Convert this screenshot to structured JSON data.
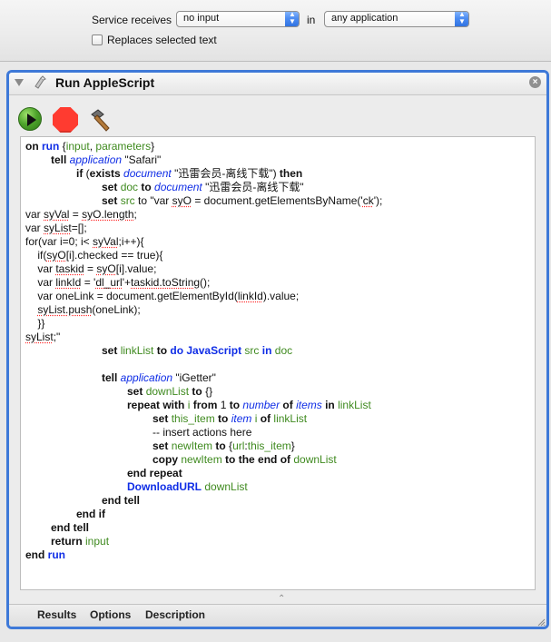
{
  "top": {
    "service_receives_label": "Service receives",
    "input_type_value": "no input",
    "in_label": "in",
    "application_value": "any application",
    "replaces_selected_text_label": "Replaces selected text",
    "replaces_selected_text_checked": false
  },
  "action": {
    "title": "Run AppleScript"
  },
  "code_lines": [
    {
      "indent": 0,
      "segments": [
        {
          "t": "on ",
          "c": "kw"
        },
        {
          "t": "run",
          "c": "kwb"
        },
        {
          "t": " {",
          "c": "str"
        },
        {
          "t": "input",
          "c": "var"
        },
        {
          "t": ", ",
          "c": "str"
        },
        {
          "t": "parameters",
          "c": "var"
        },
        {
          "t": "}",
          "c": "str"
        }
      ]
    },
    {
      "indent": 1,
      "segments": [
        {
          "t": "tell ",
          "c": "kw"
        },
        {
          "t": "application",
          "c": "app"
        },
        {
          "t": " \"Safari\"",
          "c": "str"
        }
      ]
    },
    {
      "indent": 2,
      "segments": [
        {
          "t": "if ",
          "c": "kw"
        },
        {
          "t": "(",
          "c": "str"
        },
        {
          "t": "exists ",
          "c": "kw"
        },
        {
          "t": "document",
          "c": "app"
        },
        {
          "t": " \"迅雷会员-离线下载\") ",
          "c": "str"
        },
        {
          "t": "then",
          "c": "kw"
        }
      ]
    },
    {
      "indent": 3,
      "segments": [
        {
          "t": "set ",
          "c": "kw"
        },
        {
          "t": "doc",
          "c": "var"
        },
        {
          "t": " to ",
          "c": "kw"
        },
        {
          "t": "document",
          "c": "app"
        },
        {
          "t": " \"迅雷会员-离线下载\"",
          "c": "str"
        }
      ]
    },
    {
      "indent": 3,
      "segments": [
        {
          "t": "set ",
          "c": "kw"
        },
        {
          "t": "src",
          "c": "var"
        },
        {
          "t": " to \"var ",
          "c": "str"
        },
        {
          "t": "syO",
          "c": "str",
          "u": true
        },
        {
          "t": " = document.getElementsByName('",
          "c": "str"
        },
        {
          "t": "ck",
          "c": "str",
          "u": true
        },
        {
          "t": "');",
          "c": "str"
        }
      ]
    },
    {
      "indent": 0,
      "segments": [
        {
          "t": "var ",
          "c": "str"
        },
        {
          "t": "syVal",
          "c": "str",
          "u": true
        },
        {
          "t": " = ",
          "c": "str"
        },
        {
          "t": "syO.length",
          "c": "str",
          "u": true
        },
        {
          "t": ";",
          "c": "str"
        }
      ]
    },
    {
      "indent": 0,
      "segments": [
        {
          "t": "var ",
          "c": "str"
        },
        {
          "t": "syList",
          "c": "str",
          "u": true
        },
        {
          "t": "=[];",
          "c": "str"
        }
      ]
    },
    {
      "indent": 0,
      "segments": [
        {
          "t": "for(var i=0; i< ",
          "c": "str"
        },
        {
          "t": "syVal",
          "c": "str",
          "u": true
        },
        {
          "t": ";i++){",
          "c": "str"
        }
      ]
    },
    {
      "indent": 0,
      "segments": [
        {
          "t": "    if(",
          "c": "str"
        },
        {
          "t": "syO",
          "c": "str",
          "u": true
        },
        {
          "t": "[i].checked == true){",
          "c": "str"
        }
      ]
    },
    {
      "indent": 0,
      "segments": [
        {
          "t": "    var ",
          "c": "str"
        },
        {
          "t": "taskid",
          "c": "str",
          "u": true
        },
        {
          "t": " = ",
          "c": "str"
        },
        {
          "t": "syO",
          "c": "str",
          "u": true
        },
        {
          "t": "[i].value;",
          "c": "str"
        }
      ]
    },
    {
      "indent": 0,
      "segments": [
        {
          "t": "    var ",
          "c": "str"
        },
        {
          "t": "linkId",
          "c": "str",
          "u": true
        },
        {
          "t": " = '",
          "c": "str"
        },
        {
          "t": "dl_url",
          "c": "str",
          "u": true
        },
        {
          "t": "'+",
          "c": "str"
        },
        {
          "t": "taskid.toString",
          "c": "str",
          "u": true
        },
        {
          "t": "();",
          "c": "str"
        }
      ]
    },
    {
      "indent": 0,
      "segments": [
        {
          "t": "    var ",
          "c": "str"
        },
        {
          "t": "oneLink",
          "c": "str"
        },
        {
          "t": " = document.getElementById(",
          "c": "str"
        },
        {
          "t": "linkId",
          "c": "str",
          "u": true
        },
        {
          "t": ").value;",
          "c": "str"
        }
      ]
    },
    {
      "indent": 0,
      "segments": [
        {
          "t": "    ",
          "c": "str"
        },
        {
          "t": "syList.push",
          "c": "str",
          "u": true
        },
        {
          "t": "(oneLink);",
          "c": "str"
        }
      ]
    },
    {
      "indent": 0,
      "segments": [
        {
          "t": "    }}",
          "c": "str"
        }
      ]
    },
    {
      "indent": 0,
      "segments": [
        {
          "t": "syList",
          "c": "str",
          "u": true
        },
        {
          "t": ";\"",
          "c": "str"
        }
      ]
    },
    {
      "indent": 3,
      "segments": [
        {
          "t": "set ",
          "c": "kw"
        },
        {
          "t": "linkList",
          "c": "var"
        },
        {
          "t": " to ",
          "c": "kw"
        },
        {
          "t": "do JavaScript",
          "c": "kwb"
        },
        {
          "t": " ",
          "c": "str"
        },
        {
          "t": "src",
          "c": "var"
        },
        {
          "t": " in ",
          "c": "kwb"
        },
        {
          "t": "doc",
          "c": "var"
        }
      ]
    },
    {
      "indent": 0,
      "segments": [
        {
          "t": "",
          "c": "str"
        }
      ]
    },
    {
      "indent": 3,
      "segments": [
        {
          "t": "tell ",
          "c": "kw"
        },
        {
          "t": "application",
          "c": "app"
        },
        {
          "t": " \"iGetter\"",
          "c": "str"
        }
      ]
    },
    {
      "indent": 4,
      "segments": [
        {
          "t": "set ",
          "c": "kw"
        },
        {
          "t": "downList",
          "c": "var"
        },
        {
          "t": " to ",
          "c": "kw"
        },
        {
          "t": "{}",
          "c": "str"
        }
      ]
    },
    {
      "indent": 4,
      "segments": [
        {
          "t": "repeat with ",
          "c": "kw"
        },
        {
          "t": "i",
          "c": "var"
        },
        {
          "t": " from ",
          "c": "kw"
        },
        {
          "t": "1",
          "c": "str"
        },
        {
          "t": " to ",
          "c": "kw"
        },
        {
          "t": "number",
          "c": "app"
        },
        {
          "t": " of ",
          "c": "kw"
        },
        {
          "t": "items",
          "c": "app"
        },
        {
          "t": " in ",
          "c": "kw"
        },
        {
          "t": "linkList",
          "c": "var"
        }
      ]
    },
    {
      "indent": 5,
      "segments": [
        {
          "t": "set ",
          "c": "kw"
        },
        {
          "t": "this_item",
          "c": "var"
        },
        {
          "t": " to ",
          "c": "kw"
        },
        {
          "t": "item",
          "c": "app"
        },
        {
          "t": " ",
          "c": "str"
        },
        {
          "t": "i",
          "c": "var"
        },
        {
          "t": " of ",
          "c": "kw"
        },
        {
          "t": "linkList",
          "c": "var"
        }
      ]
    },
    {
      "indent": 5,
      "segments": [
        {
          "t": "-- insert actions here",
          "c": "str"
        }
      ]
    },
    {
      "indent": 5,
      "segments": [
        {
          "t": "set ",
          "c": "kw"
        },
        {
          "t": "newItem",
          "c": "var"
        },
        {
          "t": " to ",
          "c": "kw"
        },
        {
          "t": "{",
          "c": "str"
        },
        {
          "t": "url",
          "c": "var"
        },
        {
          "t": ":",
          "c": "str"
        },
        {
          "t": "this_item",
          "c": "var"
        },
        {
          "t": "}",
          "c": "str"
        }
      ]
    },
    {
      "indent": 5,
      "segments": [
        {
          "t": "copy ",
          "c": "kw"
        },
        {
          "t": "newItem",
          "c": "var"
        },
        {
          "t": " to the end of ",
          "c": "kw"
        },
        {
          "t": "downList",
          "c": "var"
        }
      ]
    },
    {
      "indent": 4,
      "segments": [
        {
          "t": "end repeat",
          "c": "kw"
        }
      ]
    },
    {
      "indent": 4,
      "segments": [
        {
          "t": "DownloadURL",
          "c": "kwb"
        },
        {
          "t": " ",
          "c": "str"
        },
        {
          "t": "downList",
          "c": "var"
        }
      ]
    },
    {
      "indent": 3,
      "segments": [
        {
          "t": "end tell",
          "c": "kw"
        }
      ]
    },
    {
      "indent": 2,
      "segments": [
        {
          "t": "end if",
          "c": "kw"
        }
      ]
    },
    {
      "indent": 1,
      "segments": [
        {
          "t": "end tell",
          "c": "kw"
        }
      ]
    },
    {
      "indent": 1,
      "segments": [
        {
          "t": "return ",
          "c": "kw"
        },
        {
          "t": "input",
          "c": "var"
        }
      ]
    },
    {
      "indent": 0,
      "segments": [
        {
          "t": "end ",
          "c": "kw"
        },
        {
          "t": "run",
          "c": "kwb"
        }
      ]
    }
  ],
  "footer_tabs": [
    {
      "label": "Results"
    },
    {
      "label": "Options"
    },
    {
      "label": "Description"
    }
  ],
  "colors": {
    "panel_border": "#3e79d8",
    "keyword_blue": "#0f2de6",
    "variable_green": "#3f8a1f"
  }
}
